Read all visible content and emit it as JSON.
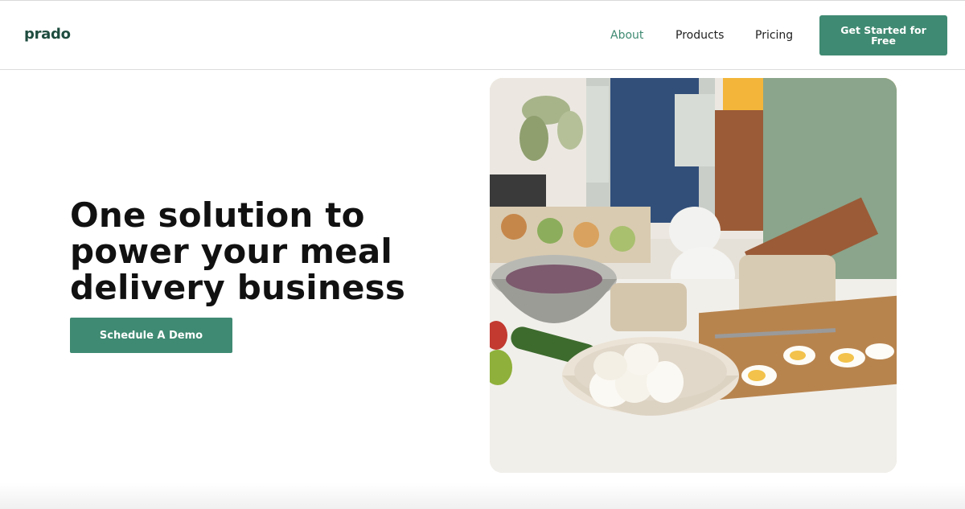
{
  "header": {
    "logo": "prado",
    "nav": [
      {
        "label": "About"
      },
      {
        "label": "Products"
      },
      {
        "label": "Pricing"
      }
    ],
    "cta_label": "Get Started for Free"
  },
  "hero": {
    "title": "One solution to power your meal delivery business",
    "cta_label": "Schedule A Demo",
    "image_icon": "meal-prep-photo"
  },
  "colors": {
    "brand_green": "#3f8a72",
    "logo_green": "#1f4d3f",
    "text": "#111111"
  }
}
